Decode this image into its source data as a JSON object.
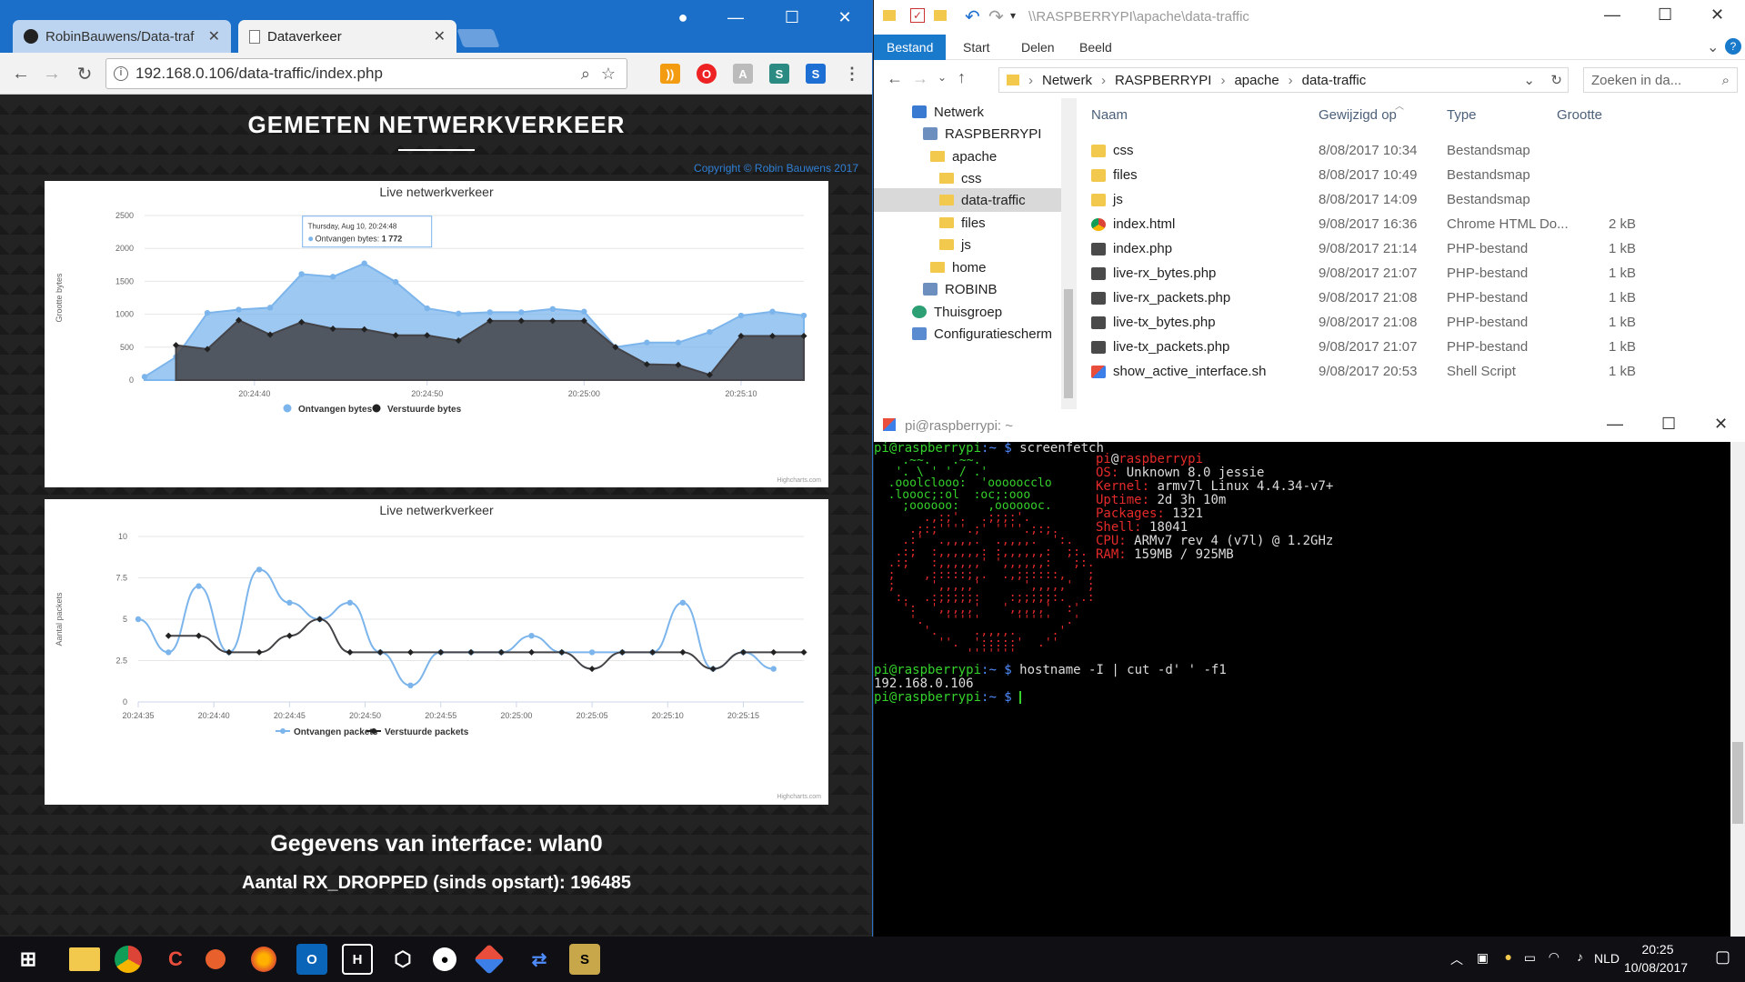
{
  "chrome": {
    "tabs": [
      {
        "title": "RobinBauwens/Data-traf"
      },
      {
        "title": "Dataverkeer"
      }
    ],
    "url": "192.168.0.106/data-traffic/index.php",
    "page": {
      "title": "GEMETEN NETWERKVERKEER",
      "copyright": "Copyright © Robin Bauwens 2017",
      "interface_heading": "Gegevens van interface: wlan0",
      "rx_dropped": "Aantal RX_DROPPED (sinds opstart): 196485"
    }
  },
  "chart_data": [
    {
      "type": "area",
      "title": "Live netwerkverkeer",
      "ylabel": "Grootte bytes",
      "xlabel": "",
      "ylim": [
        0,
        2500
      ],
      "yticks": [
        0,
        500,
        1000,
        1500,
        2000,
        2500
      ],
      "xticks": [
        "20:24:40",
        "20:24:50",
        "20:25:00",
        "20:25:10"
      ],
      "x": [
        0,
        1,
        2,
        3,
        4,
        5,
        6,
        7,
        8,
        9,
        10,
        11,
        12,
        13,
        14,
        15,
        16,
        17,
        18,
        19,
        20,
        21
      ],
      "series": [
        {
          "name": "Ontvangen bytes",
          "color": "#7cb5ec",
          "values": [
            50,
            350,
            1020,
            1070,
            1100,
            1610,
            1570,
            1772,
            1490,
            1090,
            1010,
            1030,
            1030,
            1080,
            1040,
            500,
            570,
            570,
            730,
            980,
            1040,
            980
          ]
        },
        {
          "name": "Verstuurde bytes",
          "color": "#434348",
          "values": [
            null,
            530,
            470,
            910,
            690,
            880,
            780,
            770,
            680,
            680,
            600,
            900,
            900,
            900,
            900,
            500,
            240,
            230,
            80,
            670,
            670,
            670
          ]
        }
      ],
      "legend": "bottom-center",
      "tooltip": {
        "date": "Thursday, Aug 10, 20:24:48",
        "label": "Ontvangen bytes:",
        "value": "1 772"
      },
      "credits": "Highcharts.com"
    },
    {
      "type": "line",
      "title": "Live netwerkverkeer",
      "ylabel": "Aantal packets",
      "xlabel": "",
      "ylim": [
        0,
        10
      ],
      "yticks": [
        "0",
        "2.5",
        "5",
        "7.5",
        "10"
      ],
      "xticks": [
        "20:24:35",
        "20:24:40",
        "20:24:45",
        "20:24:50",
        "20:24:55",
        "20:25:00",
        "20:25:05",
        "20:25:10",
        "20:25:15"
      ],
      "x": [
        0,
        1,
        2,
        3,
        4,
        5,
        6,
        7,
        8,
        9,
        10,
        11,
        12,
        13,
        14,
        15,
        16,
        17,
        18,
        19,
        20,
        21,
        22
      ],
      "series": [
        {
          "name": "Ontvangen packets",
          "color": "#7cb5ec",
          "values": [
            5,
            3,
            7,
            3,
            8,
            6,
            5,
            6,
            3,
            1,
            3,
            3,
            3,
            4,
            3,
            3,
            3,
            3,
            6,
            2,
            3,
            2,
            null
          ]
        },
        {
          "name": "Verstuurde packets",
          "color": "#434348",
          "values": [
            null,
            4,
            4,
            3,
            3,
            4,
            5,
            3,
            3,
            3,
            3,
            3,
            3,
            3,
            3,
            2,
            3,
            3,
            3,
            2,
            3,
            3,
            3
          ]
        }
      ],
      "legend": "bottom-center",
      "credits": "Highcharts.com"
    }
  ],
  "explorer": {
    "title_path": "\\\\RASPBERRYPI\\apache\\data-traffic",
    "ribbon_tabs": [
      "Bestand",
      "Start",
      "Delen",
      "Beeld"
    ],
    "breadcrumb": [
      "Netwerk",
      "RASPBERRYPI",
      "apache",
      "data-traffic"
    ],
    "search_placeholder": "Zoeken in da...",
    "nav": [
      {
        "label": "Netwerk"
      },
      {
        "label": "RASPBERRYPI"
      },
      {
        "label": "apache"
      },
      {
        "label": "css"
      },
      {
        "label": "data-traffic"
      },
      {
        "label": "files"
      },
      {
        "label": "js"
      },
      {
        "label": "home"
      },
      {
        "label": "ROBINB"
      },
      {
        "label": "Thuisgroep"
      },
      {
        "label": "Configuratiescherm"
      }
    ],
    "columns": [
      "Naam",
      "Gewijzigd op",
      "Type",
      "Grootte"
    ],
    "files": [
      {
        "name": "css",
        "date": "8/08/2017 10:34",
        "type": "Bestandsmap",
        "size": ""
      },
      {
        "name": "files",
        "date": "8/08/2017 10:49",
        "type": "Bestandsmap",
        "size": ""
      },
      {
        "name": "js",
        "date": "8/08/2017 14:09",
        "type": "Bestandsmap",
        "size": ""
      },
      {
        "name": "index.html",
        "date": "9/08/2017 16:36",
        "type": "Chrome HTML Do...",
        "size": "2 kB"
      },
      {
        "name": "index.php",
        "date": "9/08/2017 21:14",
        "type": "PHP-bestand",
        "size": "1 kB"
      },
      {
        "name": "live-rx_bytes.php",
        "date": "9/08/2017 21:07",
        "type": "PHP-bestand",
        "size": "1 kB"
      },
      {
        "name": "live-rx_packets.php",
        "date": "9/08/2017 21:08",
        "type": "PHP-bestand",
        "size": "1 kB"
      },
      {
        "name": "live-tx_bytes.php",
        "date": "9/08/2017 21:08",
        "type": "PHP-bestand",
        "size": "1 kB"
      },
      {
        "name": "live-tx_packets.php",
        "date": "9/08/2017 21:07",
        "type": "PHP-bestand",
        "size": "1 kB"
      },
      {
        "name": "show_active_interface.sh",
        "date": "9/08/2017 20:53",
        "type": "Shell Script",
        "size": "1 kB"
      }
    ]
  },
  "terminal": {
    "title": "pi@raspberrypi: ~",
    "prompt_user": "pi@raspberrypi",
    "prompt_path": ":~ $",
    "cmd1": "screenfetch",
    "info_user": "pi",
    "info_host": "raspberrypi",
    "info": [
      {
        "k": "OS:",
        "v": "Unknown 8.0 jessie"
      },
      {
        "k": "Kernel:",
        "v": "armv7l Linux 4.4.34-v7+"
      },
      {
        "k": "Uptime:",
        "v": "2d 3h 10m"
      },
      {
        "k": "Packages:",
        "v": "1321"
      },
      {
        "k": "Shell:",
        "v": "18041"
      },
      {
        "k": "CPU:",
        "v": "ARMv7 rev 4 (v7l) @ 1.2GHz"
      },
      {
        "k": "RAM:",
        "v": "159MB / 925MB"
      }
    ],
    "cmd2": "hostname -I | cut -d' ' -f1",
    "output2": "192.168.0.106"
  },
  "taskbar": {
    "language": "NLD",
    "time": "20:25",
    "date": "10/08/2017"
  }
}
